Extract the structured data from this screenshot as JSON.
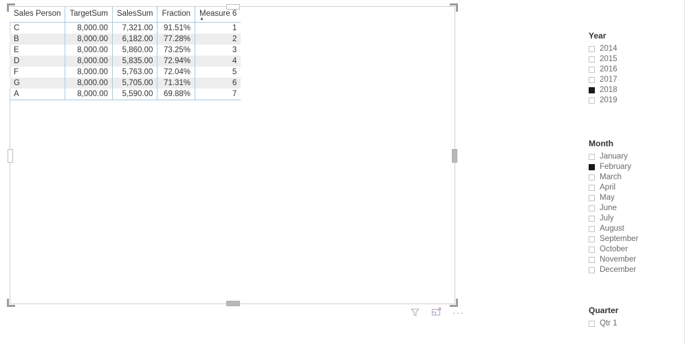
{
  "visual": {
    "name": "sales-person-table",
    "table": {
      "columns": [
        {
          "label": "Sales Person",
          "align": "left"
        },
        {
          "label": "TargetSum",
          "align": "right"
        },
        {
          "label": "SalesSum",
          "align": "right"
        },
        {
          "label": "Fraction",
          "align": "right"
        },
        {
          "label": "Measure 6",
          "align": "right"
        }
      ],
      "sort": {
        "column": "Measure 6",
        "direction": "ascending",
        "glyph": "▲"
      },
      "rows": [
        [
          "C",
          "8,000.00",
          "7,321.00",
          "91.51%",
          "1"
        ],
        [
          "B",
          "8,000.00",
          "6,182.00",
          "77.28%",
          "2"
        ],
        [
          "E",
          "8,000.00",
          "5,860.00",
          "73.25%",
          "3"
        ],
        [
          "D",
          "8,000.00",
          "5,835.00",
          "72.94%",
          "4"
        ],
        [
          "F",
          "8,000.00",
          "5,763.00",
          "72.04%",
          "5"
        ],
        [
          "G",
          "8,000.00",
          "5,705.00",
          "71.31%",
          "6"
        ],
        [
          "A",
          "8,000.00",
          "5,590.00",
          "69.88%",
          "7"
        ]
      ]
    },
    "footer": {
      "filter_icon": "filter-icon",
      "focus_icon": "focus-mode-icon",
      "more_label": "···"
    }
  },
  "slicers": [
    {
      "id": "year",
      "title": "Year",
      "items": [
        {
          "label": "2014",
          "checked": false
        },
        {
          "label": "2015",
          "checked": false
        },
        {
          "label": "2016",
          "checked": false
        },
        {
          "label": "2017",
          "checked": false
        },
        {
          "label": "2018",
          "checked": true
        },
        {
          "label": "2019",
          "checked": false
        }
      ]
    },
    {
      "id": "month",
      "title": "Month",
      "items": [
        {
          "label": "January",
          "checked": false
        },
        {
          "label": "February",
          "checked": true
        },
        {
          "label": "March",
          "checked": false
        },
        {
          "label": "April",
          "checked": false
        },
        {
          "label": "May",
          "checked": false
        },
        {
          "label": "June",
          "checked": false
        },
        {
          "label": "July",
          "checked": false
        },
        {
          "label": "August",
          "checked": false
        },
        {
          "label": "September",
          "checked": false
        },
        {
          "label": "October",
          "checked": false
        },
        {
          "label": "November",
          "checked": false
        },
        {
          "label": "December",
          "checked": false
        }
      ]
    },
    {
      "id": "quarter",
      "title": "Quarter",
      "items": [
        {
          "label": "Qtr 1",
          "checked": false
        }
      ]
    }
  ],
  "colors": {
    "grid_line": "#a8cae6",
    "alt_row": "#ededed",
    "visual_border": "#d0d0d0",
    "checkbox_checked": "#1a1a1a",
    "footer_icon": "#b9a8c4",
    "text": "#333333",
    "slicer_label": "#6b6b6b"
  }
}
